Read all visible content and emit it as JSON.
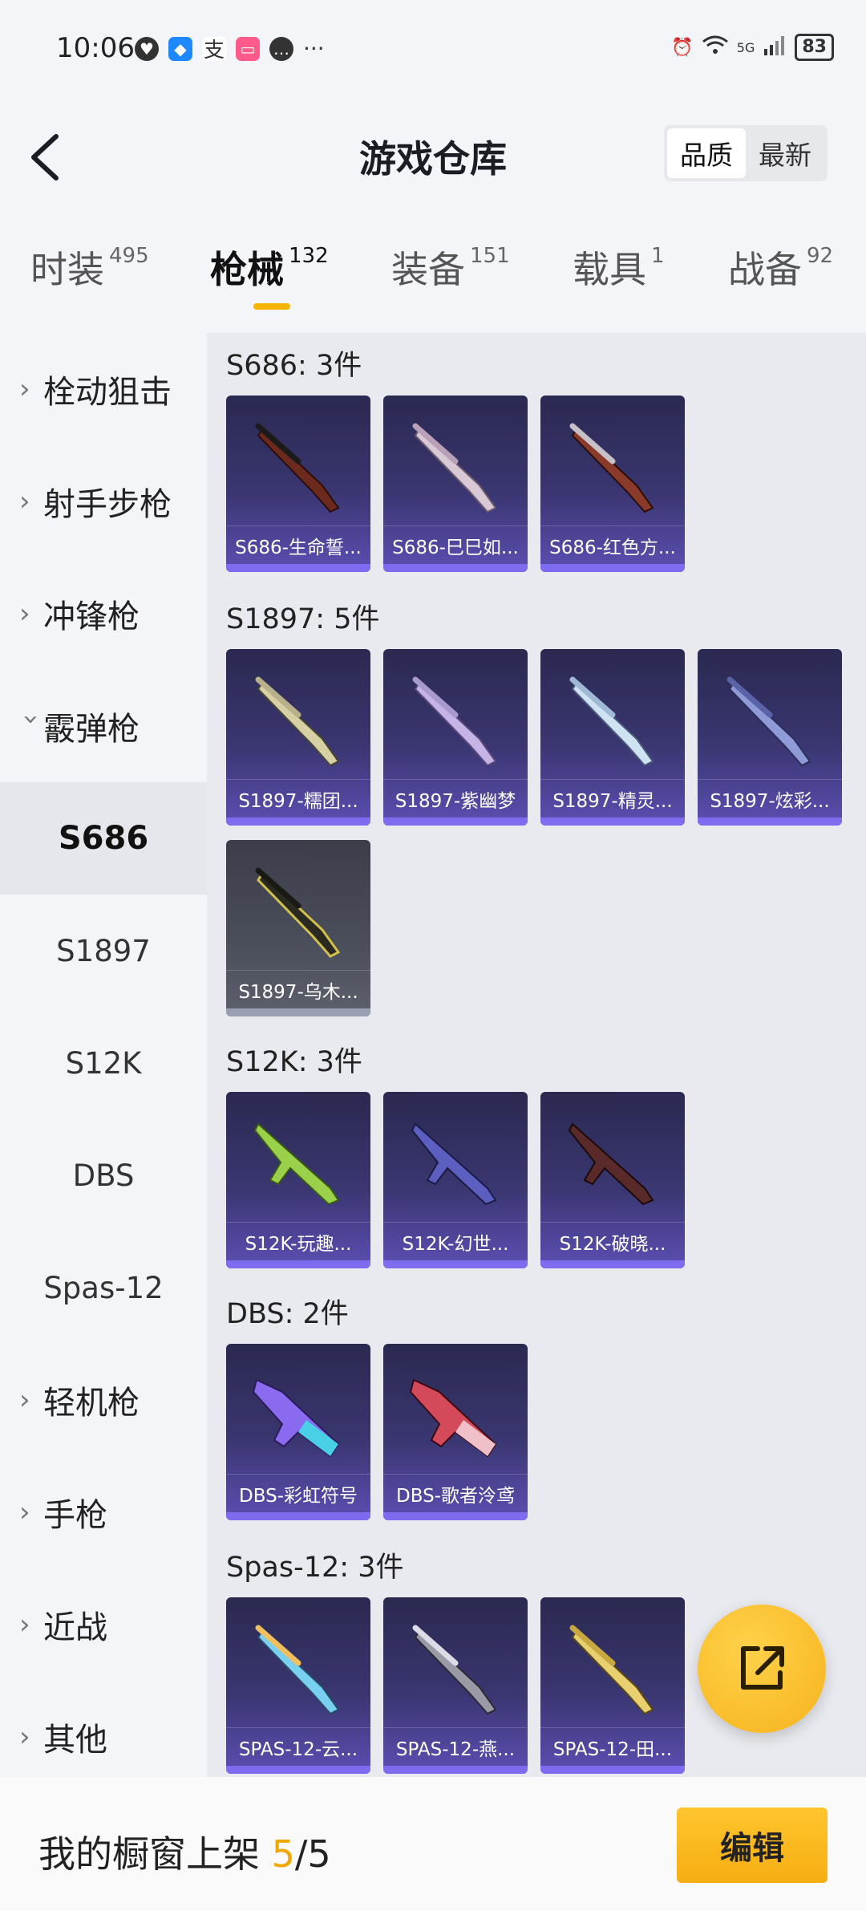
{
  "status_bar": {
    "time": "10:06",
    "battery": "83",
    "network": "5G"
  },
  "header": {
    "title": "游戏仓库",
    "sort_options": [
      "品质",
      "最新"
    ],
    "sort_active": "品质"
  },
  "tabs": [
    {
      "label": "时装",
      "count": "495"
    },
    {
      "label": "枪械",
      "count": "132",
      "active": true
    },
    {
      "label": "装备",
      "count": "151"
    },
    {
      "label": "载具",
      "count": "1"
    },
    {
      "label": "战备",
      "count": "92"
    }
  ],
  "sidebar": {
    "categories": [
      "栓动狙击",
      "射手步枪",
      "冲锋枪",
      "霰弹枪",
      "轻机枪",
      "手枪",
      "近战",
      "其他"
    ],
    "expanded": "霰弹枪",
    "subitems": [
      "S686",
      "S1897",
      "S12K",
      "DBS",
      "Spas-12"
    ],
    "active_sub": "S686"
  },
  "groups": [
    {
      "title": "S686: 3件",
      "items": [
        "S686-生命誓...",
        "S686-巳巳如...",
        "S686-红色方..."
      ]
    },
    {
      "title": "S1897: 5件",
      "items": [
        "S1897-糯团...",
        "S1897-紫幽梦",
        "S1897-精灵...",
        "S1897-炫彩...",
        "S1897-乌木..."
      ]
    },
    {
      "title": "S12K: 3件",
      "items": [
        "S12K-玩趣...",
        "S12K-幻世...",
        "S12K-破晓..."
      ]
    },
    {
      "title": "DBS: 2件",
      "items": [
        "DBS-彩虹符号",
        "DBS-歌者泠鸢"
      ]
    },
    {
      "title": "Spas-12: 3件",
      "items": [
        "SPAS-12-云...",
        "SPAS-12-燕...",
        "SPAS-12-田..."
      ]
    }
  ],
  "bottom": {
    "label": "我的橱窗上架",
    "current": "5",
    "separator": "/",
    "total": "5",
    "edit_label": "编辑"
  },
  "colors": {
    "accent": "#f5b400",
    "card_bg": "#3a3671",
    "card_bar": "#7d6cf0"
  },
  "icons": {
    "back": "chevron-left-icon",
    "share": "share-external-icon"
  }
}
